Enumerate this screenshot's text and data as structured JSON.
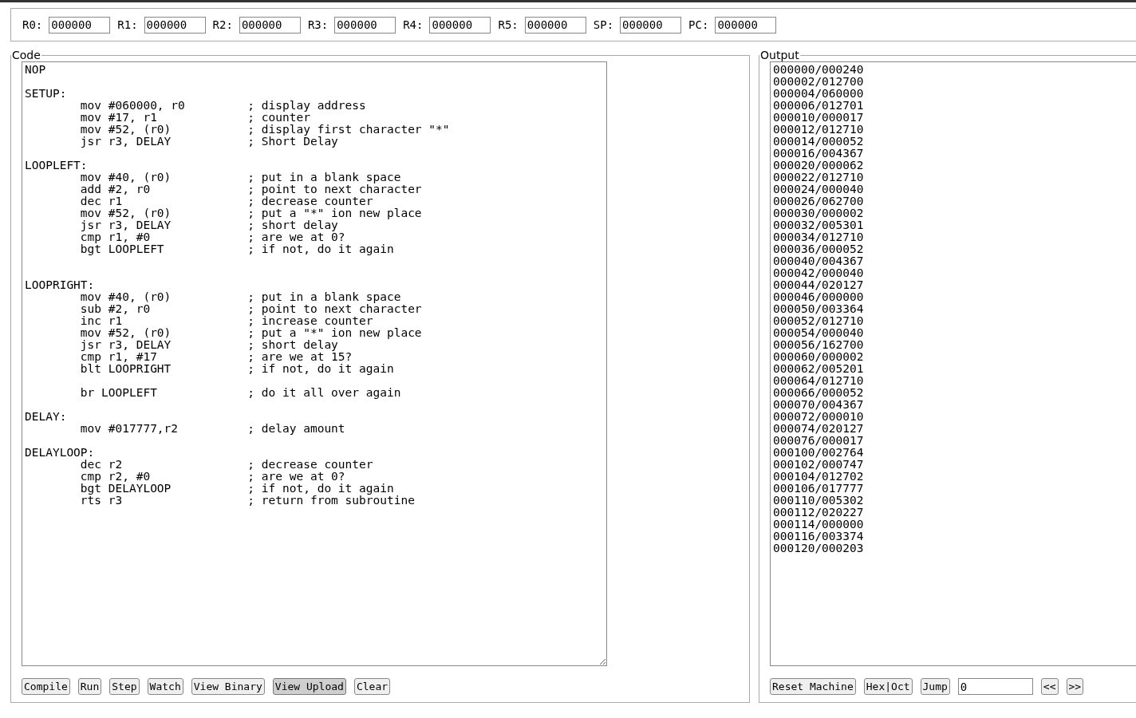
{
  "registers": [
    {
      "label": "R0:",
      "value": "000000"
    },
    {
      "label": "R1:",
      "value": "000000"
    },
    {
      "label": "R2:",
      "value": "000000"
    },
    {
      "label": "R3:",
      "value": "000000"
    },
    {
      "label": "R4:",
      "value": "000000"
    },
    {
      "label": "R5:",
      "value": "000000"
    },
    {
      "label": "SP:",
      "value": "000000"
    },
    {
      "label": "PC:",
      "value": "000000"
    }
  ],
  "code_panel": {
    "legend": "Code",
    "code": "NOP\n\nSETUP:\n\tmov #060000, r0\t\t; display address\n\tmov #17, r1\t\t; counter\n\tmov #52, (r0)\t\t; display first character \"*\"\n\tjsr r3, DELAY\t\t; Short Delay\n\nLOOPLEFT:\n\tmov #40, (r0)\t\t; put in a blank space\n\tadd #2, r0\t\t; point to next character\n\tdec r1\t\t\t; decrease counter\n\tmov #52, (r0)\t\t; put a \"*\" ion new place\n\tjsr r3, DELAY\t\t; short delay\n\tcmp r1, #0\t\t; are we at 0?\n\tbgt LOOPLEFT\t\t; if not, do it again\n\n\nLOOPRIGHT:\n\tmov #40, (r0)\t\t; put in a blank space\n\tsub #2, r0\t\t; point to next character\n\tinc r1\t\t\t; increase counter\n\tmov #52, (r0)\t\t; put a \"*\" ion new place\n\tjsr r3, DELAY\t\t; short delay\n\tcmp r1, #17\t\t; are we at 15?\n\tblt LOOPRIGHT\t\t; if not, do it again\n\n\tbr LOOPLEFT\t\t; do it all over again\n\nDELAY:\n\tmov #017777,r2\t\t; delay amount\n\nDELAYLOOP:\n\tdec r2\t\t\t; decrease counter\n\tcmp r2, #0\t\t; are we at 0?\n\tbgt DELAYLOOP\t\t; if not, do it again\n\trts r3\t\t\t; return from subroutine",
    "buttons": [
      {
        "label": "Compile",
        "pressed": false
      },
      {
        "label": "Run",
        "pressed": false
      },
      {
        "label": "Step",
        "pressed": false
      },
      {
        "label": "Watch",
        "pressed": false
      },
      {
        "label": "View Binary",
        "pressed": false
      },
      {
        "label": "View Upload",
        "pressed": true
      },
      {
        "label": "Clear",
        "pressed": false
      }
    ]
  },
  "output_panel": {
    "legend": "Output",
    "output": "000000/000240\n000002/012700\n000004/060000\n000006/012701\n000010/000017\n000012/012710\n000014/000052\n000016/004367\n000020/000062\n000022/012710\n000024/000040\n000026/062700\n000030/000002\n000032/005301\n000034/012710\n000036/000052\n000040/004367\n000042/000040\n000044/020127\n000046/000000\n000050/003364\n000052/012710\n000054/000040\n000056/162700\n000060/000002\n000062/005201\n000064/012710\n000066/000052\n000070/004367\n000072/000010\n000074/020127\n000076/000017\n000100/002764\n000102/000747\n000104/012702\n000106/017777\n000110/005302\n000112/020227\n000114/000000\n000116/003374\n000120/000203",
    "reset_button": "Reset Machine",
    "format_button": "Hex|Oct",
    "jump_button": "Jump",
    "jump_address": "0",
    "prev_button": "<<",
    "next_button": ">>"
  }
}
